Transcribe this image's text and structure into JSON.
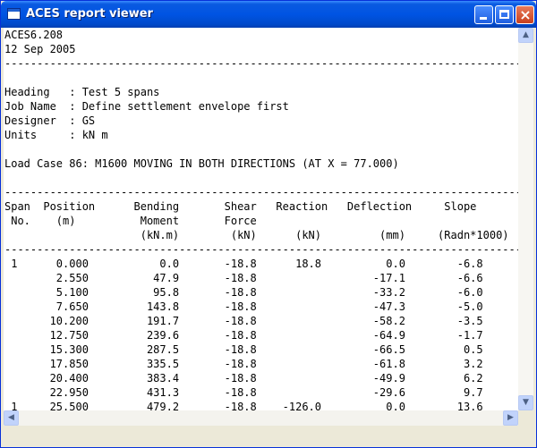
{
  "window": {
    "title": "ACES report viewer",
    "buttons": {
      "minimize": "minimize",
      "maximize": "maximize",
      "close": "close"
    }
  },
  "report": {
    "lines": [
      "ACES6.208",
      "12 Sep 2005",
      "---------------------------------------------------------------------------------",
      "",
      "Heading   : Test 5 spans",
      "Job Name  : Define settlement envelope first",
      "Designer  : GS",
      "Units     : kN m",
      "",
      "Load Case 86: M1600 MOVING IN BOTH DIRECTIONS (AT X = 77.000)",
      "",
      "---------------------------------------------------------------------------------",
      "Span  Position      Bending       Shear   Reaction   Deflection     Slope",
      " No.    (m)          Moment       Force",
      "                     (kN.m)        (kN)      (kN)         (mm)     (Radn*1000)",
      "---------------------------------------------------------------------------------",
      " 1      0.000           0.0       -18.8      18.8          0.0        -6.8",
      "        2.550          47.9       -18.8                  -17.1        -6.6",
      "        5.100          95.8       -18.8                  -33.2        -6.0",
      "        7.650         143.8       -18.8                  -47.3        -5.0",
      "       10.200         191.7       -18.8                  -58.2        -3.5",
      "       12.750         239.6       -18.8                  -64.9        -1.7",
      "       15.300         287.5       -18.8                  -66.5         0.5",
      "       17.850         335.5       -18.8                  -61.8         3.2",
      "       20.400         383.4       -18.8                  -49.9         6.2",
      "       22.950         431.3       -18.8                  -29.6         9.7",
      " 1     25.500         479.2       -18.8    -126.0          0.0        13.6",
      "---------------------------------------------------------------------------------"
    ]
  },
  "scrollbars": {
    "up_arrow": "▲",
    "down_arrow": "▼",
    "left_arrow": "◀",
    "right_arrow": "▶"
  }
}
